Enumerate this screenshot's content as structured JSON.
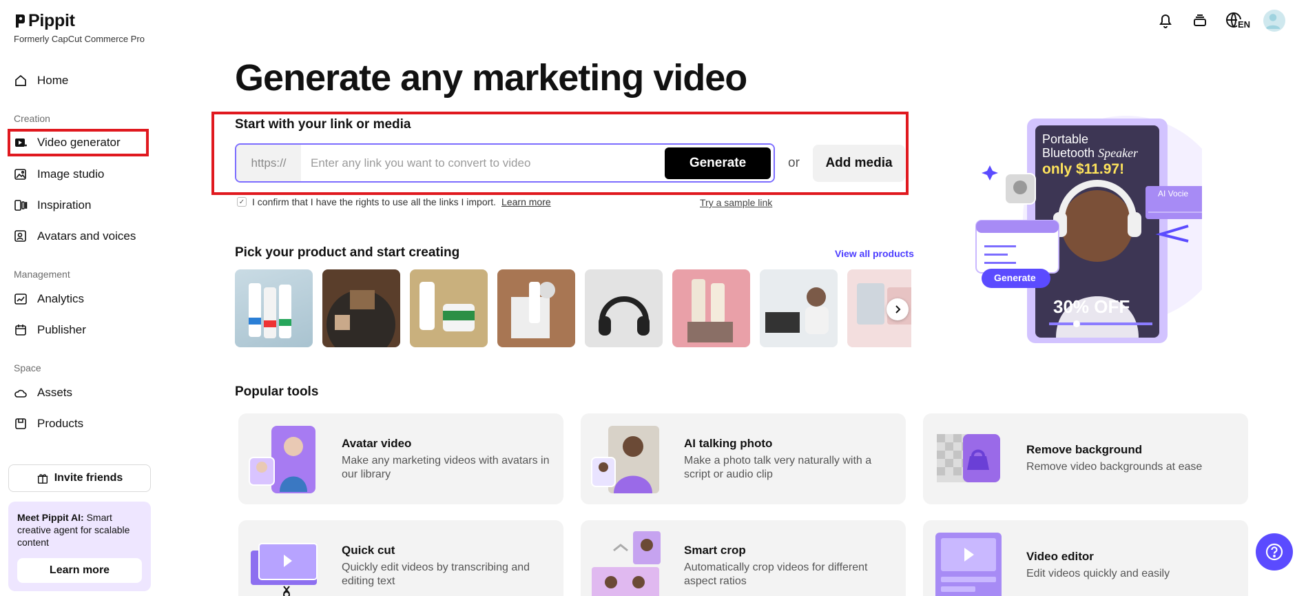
{
  "brand": {
    "name": "Pippit",
    "subtitle": "Formerly CapCut Commerce Pro"
  },
  "sidebar": {
    "home": "Home",
    "sections": {
      "creation": "Creation",
      "management": "Management",
      "space": "Space"
    },
    "items": {
      "video_generator": "Video generator",
      "image_studio": "Image studio",
      "inspiration": "Inspiration",
      "avatars_voices": "Avatars and voices",
      "analytics": "Analytics",
      "publisher": "Publisher",
      "assets": "Assets",
      "products": "Products"
    },
    "invite": "Invite friends",
    "promo": {
      "title": "Meet Pippit AI:",
      "text": "Smart creative agent for scalable content",
      "button": "Learn more"
    }
  },
  "header": {
    "language": "EN"
  },
  "main": {
    "title": "Generate any marketing video",
    "start_label": "Start with your link or media",
    "url_prefix": "https://",
    "url_placeholder": "Enter any link you want to convert to video",
    "generate": "Generate",
    "or": "or",
    "add_media": "Add media",
    "confirm_text": "I confirm that I have the rights to use all the links I import.",
    "learn_more": "Learn more",
    "sample_link": "Try a sample link",
    "pick_title": "Pick your product and start creating",
    "view_all": "View all products",
    "popular_title": "Popular tools"
  },
  "hero_card": {
    "line1": "Portable",
    "line2": "Bluetooth",
    "line2b": "Speaker",
    "price": "only $11.97!",
    "ai_label": "AI Vocie",
    "generate": "Generate",
    "discount": "30% OFF"
  },
  "tools": [
    {
      "name": "Avatar video",
      "desc": "Make any marketing videos with avatars in our library"
    },
    {
      "name": "AI talking photo",
      "desc": "Make a photo talk very naturally with a script or audio clip"
    },
    {
      "name": "Remove background",
      "desc": "Remove video backgrounds at ease"
    },
    {
      "name": "Quick cut",
      "desc": "Quickly edit videos by transcribing and editing text"
    },
    {
      "name": "Smart crop",
      "desc": "Automatically crop videos for different aspect ratios"
    },
    {
      "name": "Video editor",
      "desc": "Edit videos quickly and easily"
    }
  ],
  "colors": {
    "accent": "#5b4bff",
    "highlight_box": "#e0191f",
    "promo_bg": "#eee6ff"
  }
}
